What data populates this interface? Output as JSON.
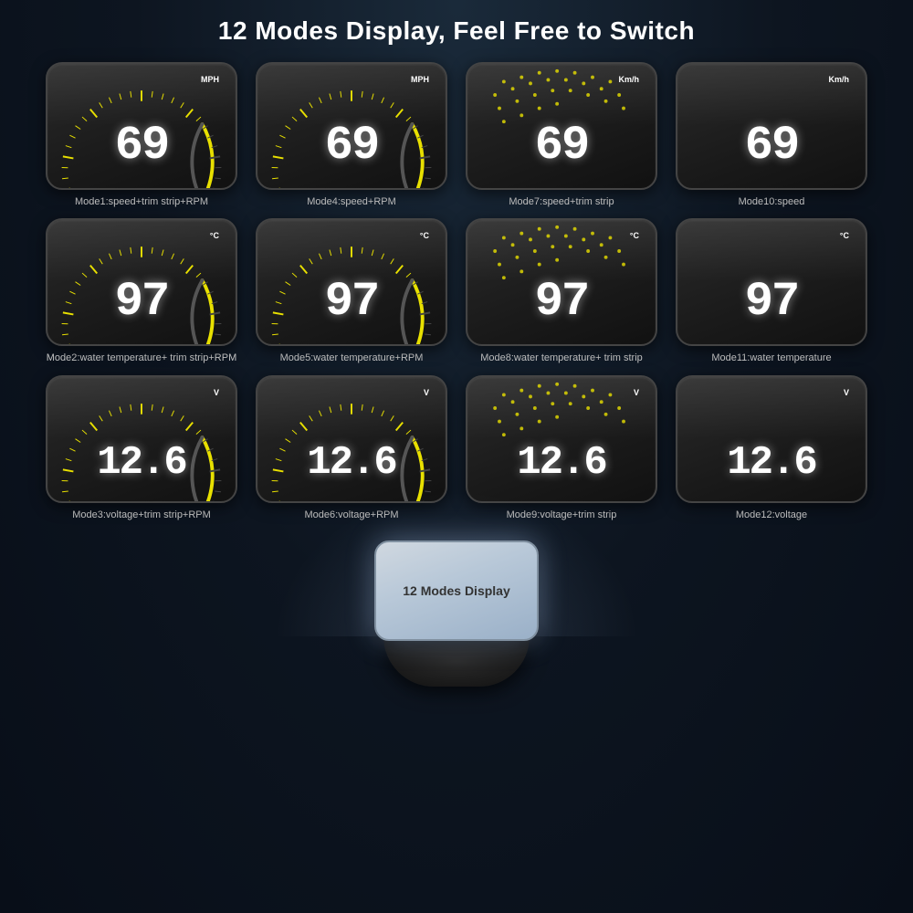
{
  "header": {
    "title": "12 Modes Display, Feel Free to Switch"
  },
  "modes": [
    {
      "id": "mode1",
      "label": "Mode1:speed+trim strip+RPM",
      "value": "69",
      "unit": "MPH",
      "hasGauge": true,
      "hasDots": false,
      "type": "speed"
    },
    {
      "id": "mode4",
      "label": "Mode4:speed+RPM",
      "value": "69",
      "unit": "MPH",
      "hasGauge": true,
      "hasDots": false,
      "type": "speed"
    },
    {
      "id": "mode7",
      "label": "Mode7:speed+trim strip",
      "value": "69",
      "unit": "Km/h",
      "hasGauge": false,
      "hasDots": true,
      "type": "speed"
    },
    {
      "id": "mode10",
      "label": "Mode10:speed",
      "value": "69",
      "unit": "Km/h",
      "hasGauge": false,
      "hasDots": false,
      "type": "speed"
    },
    {
      "id": "mode2",
      "label": "Mode2:water temperature+\ntrim strip+RPM",
      "value": "97",
      "unit": "°C",
      "hasGauge": true,
      "hasDots": false,
      "type": "temp"
    },
    {
      "id": "mode5",
      "label": "Mode5:water temperature+RPM",
      "value": "97",
      "unit": "°C",
      "hasGauge": true,
      "hasDots": false,
      "type": "temp"
    },
    {
      "id": "mode8",
      "label": "Mode8:water temperature+\ntrim strip",
      "value": "97",
      "unit": "°C",
      "hasGauge": false,
      "hasDots": true,
      "type": "temp"
    },
    {
      "id": "mode11",
      "label": "Mode11:water temperature",
      "value": "97",
      "unit": "°C",
      "hasGauge": false,
      "hasDots": false,
      "type": "temp"
    },
    {
      "id": "mode3",
      "label": "Mode3:voltage+trim strip+RPM",
      "value": "12.6",
      "unit": "V",
      "hasGauge": true,
      "hasDots": false,
      "type": "voltage"
    },
    {
      "id": "mode6",
      "label": "Mode6:voltage+RPM",
      "value": "12.6",
      "unit": "V",
      "hasGauge": true,
      "hasDots": false,
      "type": "voltage"
    },
    {
      "id": "mode9",
      "label": "Mode9:voltage+trim strip",
      "value": "12.6",
      "unit": "V",
      "hasGauge": false,
      "hasDots": true,
      "type": "voltage"
    },
    {
      "id": "mode12",
      "label": "Mode12:voltage",
      "value": "12.6",
      "unit": "V",
      "hasGauge": false,
      "hasDots": false,
      "type": "voltage"
    }
  ],
  "device": {
    "screen_label": "12 Modes Display"
  }
}
